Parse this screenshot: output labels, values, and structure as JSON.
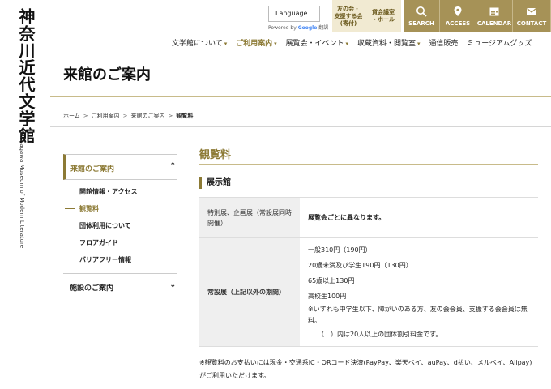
{
  "logo": {
    "title": "神奈川近代文学館",
    "subtitle": "Kanagawa Museum of Modern Literature"
  },
  "header": {
    "language_label": "Language",
    "powered_by": "Powered by",
    "google": "Google",
    "translate": "翻訳",
    "friends_button": [
      "友の会・",
      "支援する会",
      "(寄付)"
    ],
    "rental_button": [
      "貸会議室",
      "・ホール"
    ],
    "icon_buttons": [
      {
        "label": "SEARCH",
        "icon": "search-icon"
      },
      {
        "label": "ACCESS",
        "icon": "location-pin-icon"
      },
      {
        "label": "CALENDAR",
        "icon": "calendar-icon"
      },
      {
        "label": "CONTACT",
        "icon": "mail-icon"
      }
    ],
    "accent_color": "#a69257"
  },
  "nav": {
    "items": [
      "文学館について",
      "ご利用案内",
      "展覧会・イベント",
      "収蔵資料・閲覧室",
      "通信販売",
      "ミュージアムグッズ"
    ],
    "active": "ご利用案内"
  },
  "page": {
    "title": "来館のご案内"
  },
  "breadcrumb": [
    "ホーム",
    "ご利用案内",
    "来館のご案内",
    "観覧料"
  ],
  "sidebar": {
    "section1": "来館のご案内",
    "items": [
      "開館情報・アクセス",
      "観覧料",
      "団体利用について",
      "フロアガイド",
      "バリアフリー情報"
    ],
    "current": "観覧料",
    "section2": "施設のご案内"
  },
  "main": {
    "section_title": "観覧料",
    "subsection_title": "展示館",
    "rows": [
      {
        "label": "特別展、企画展（常設展同時開催）",
        "value": "展覧会ごとに異なります。"
      },
      {
        "label": "常設展（上記以外の期間）",
        "prices": [
          "一般310円（190円）",
          "20歳未満及び学生190円（130円）",
          "65歳以上130円",
          "高校生100円"
        ],
        "note": "※いずれも中学生以下、障がいのある方、友の会会員、支援する会会員は無料。",
        "group_note": "（　）内は20人以上の団体割引料金です。"
      }
    ],
    "footnote": "※観覧料のお支払いには現金・交通系IC・QRコード決済(PayPay、楽天ペイ、auPay、d払い、メルペイ、Alipay)がご利用いただけます。"
  }
}
